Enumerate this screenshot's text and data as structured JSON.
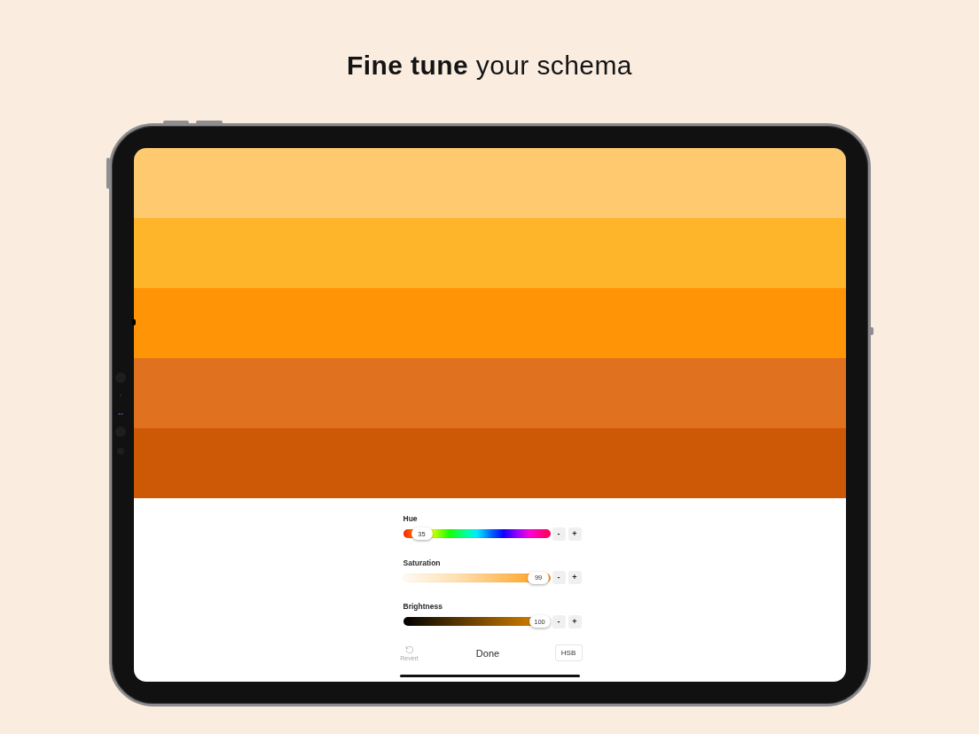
{
  "headline": "**Fine tune** your schema",
  "palette": [
    {
      "color": "#ffc970"
    },
    {
      "color": "#ffb52a"
    },
    {
      "color": "#ff9506"
    },
    {
      "color": "#e0711e"
    },
    {
      "color": "#cd5806"
    }
  ],
  "sliders": [
    {
      "label": "Hue",
      "kind": "hue",
      "level": 0.05,
      "reading": "35",
      "decrement": "-",
      "increment": "+"
    },
    {
      "label": "Saturation",
      "kind": "saturation",
      "level": 0.99,
      "reading": "99",
      "decrement": "-",
      "increment": "+"
    },
    {
      "label": "Brightness",
      "kind": "brightness",
      "level": 1,
      "reading": "100",
      "decrement": "-",
      "increment": "+"
    }
  ],
  "revert": {
    "label": "Revert",
    "disabled": true
  },
  "done": "Done",
  "mode": "HSB"
}
